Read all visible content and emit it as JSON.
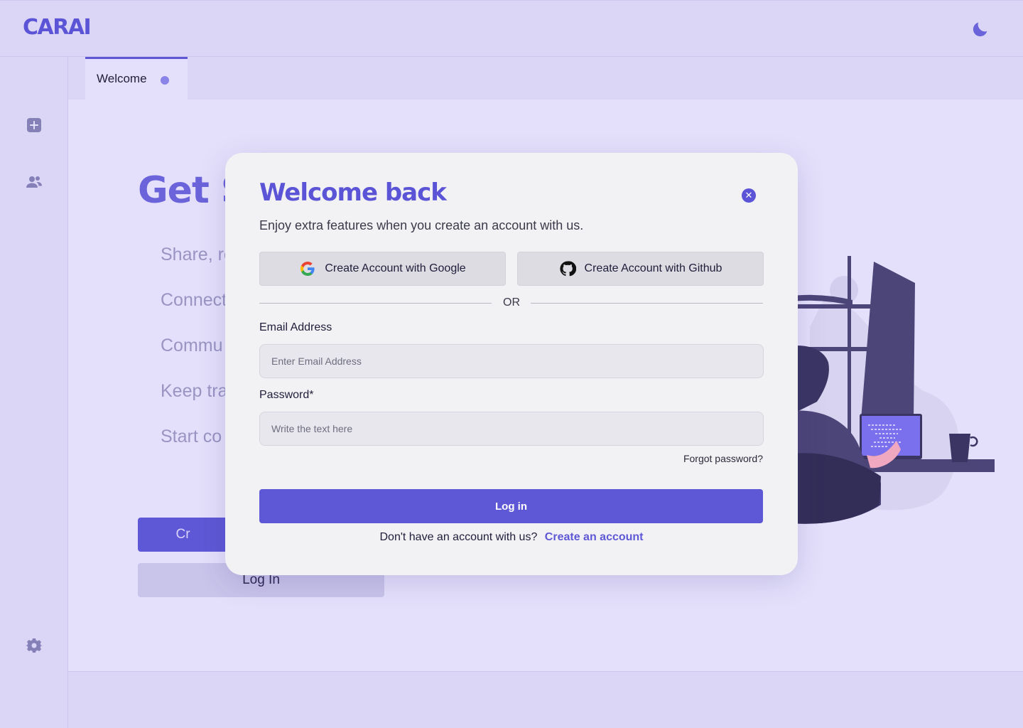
{
  "app": {
    "logo": "CARAI",
    "theme_toggle_icon": "moon-icon",
    "accent_color": "#5f58d6"
  },
  "sidebar": {
    "items": [
      {
        "icon": "add-square-icon"
      },
      {
        "icon": "users-icon"
      },
      {
        "icon": "gear-icon"
      }
    ]
  },
  "tabs": [
    {
      "label": "Welcome",
      "unsaved_indicator": true
    }
  ],
  "background": {
    "title": "Get S",
    "items": [
      "Share, re",
      "Connect",
      "Commu",
      "Keep tra",
      "Start co"
    ],
    "create_button": "Cr",
    "login_button": "Log In"
  },
  "modal": {
    "title": "Welcome back",
    "subtitle": "Enjoy extra features when you create an account with us.",
    "close_icon": "close-icon",
    "google_button": "Create Account with Google",
    "github_button": "Create Account with Github",
    "divider": "OR",
    "email_label": "Email Address",
    "email_placeholder": "Enter Email Address",
    "email_value": "",
    "password_label": "Password*",
    "password_placeholder": "Write the text here",
    "password_value": "",
    "forgot_password": "Forgot password?",
    "login_button": "Log in",
    "signup_prompt": "Don't have an account with us?",
    "signup_link": "Create an account"
  }
}
